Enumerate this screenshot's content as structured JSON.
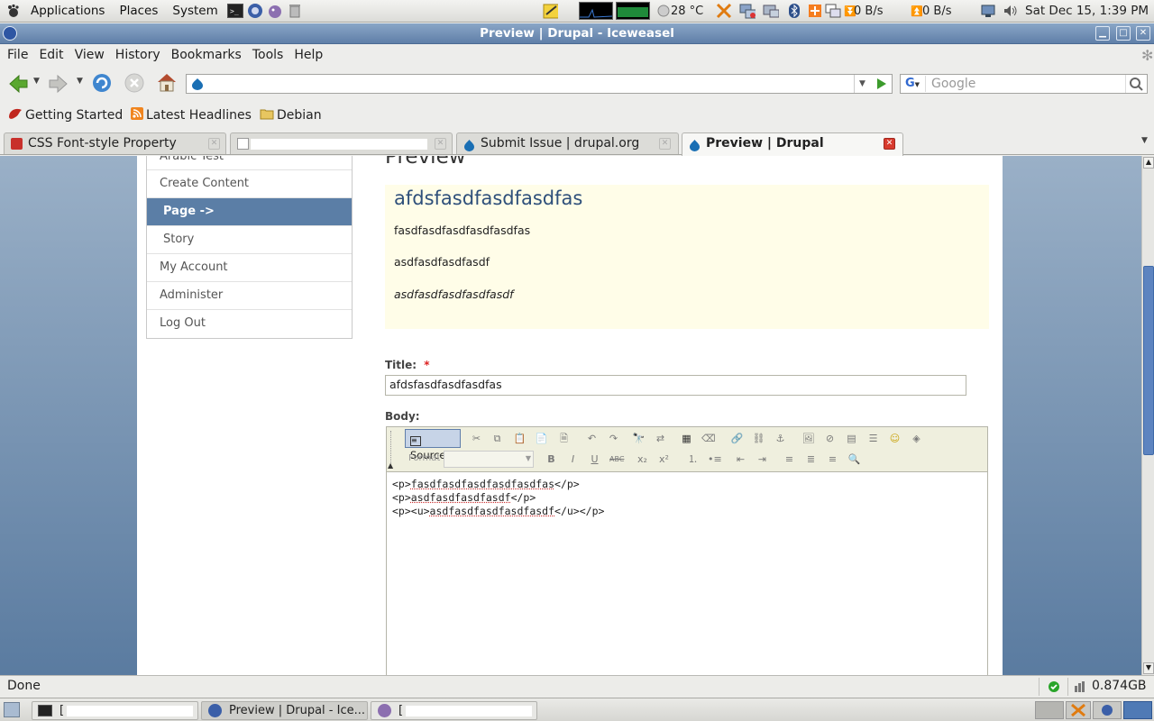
{
  "top_panel": {
    "menus": [
      "Applications",
      "Places",
      "System"
    ],
    "temperature": "28 °C",
    "net_down": "0 B/s",
    "net_up": "0 B/s",
    "clock": "Sat Dec 15,  1:39 PM"
  },
  "window": {
    "title": "Preview | Drupal - Iceweasel"
  },
  "menubar": [
    "File",
    "Edit",
    "View",
    "History",
    "Bookmarks",
    "Tools",
    "Help"
  ],
  "navbar": {
    "url": "",
    "search_placeholder": "Google"
  },
  "bookmarks": [
    "Getting Started",
    "Latest Headlines",
    "Debian"
  ],
  "tabs": [
    {
      "label": "CSS Font-style Property"
    },
    {
      "label": ""
    },
    {
      "label": "Submit Issue | drupal.org"
    },
    {
      "label": "Preview | Drupal"
    }
  ],
  "sidebar": {
    "items": [
      {
        "label": "Arabic Test"
      },
      {
        "label": "Create Content"
      },
      {
        "label": "Page ->"
      },
      {
        "label": "Story"
      },
      {
        "label": "My Account"
      },
      {
        "label": "Administer"
      },
      {
        "label": "Log Out"
      }
    ]
  },
  "main": {
    "heading": "Preview",
    "preview": {
      "title": "afdsfasdfasdfasdfas",
      "paragraphs": [
        "fasdfasdfasdfasdfasdfas",
        "asdfasdfasdfasdf",
        "asdfasdfasdfasdfasdf"
      ]
    },
    "title_label": "Title:",
    "required_mark": "*",
    "title_value": "afdsfasdfasdfasdfas",
    "body_label": "Body:",
    "editor": {
      "source_label": "Source",
      "format_label": "Format",
      "lines": [
        {
          "open": "<p>",
          "text": "fasdfasdfasdfasdfasdfas",
          "close": "</p>"
        },
        {
          "open": "<p>",
          "text": "asdfasdfasdfasdf",
          "close": "</p>"
        },
        {
          "open": "<p><u>",
          "text": "asdfasdfasdfasdfasdf",
          "close": "</u></p>"
        }
      ]
    }
  },
  "statusbar": {
    "status": "Done",
    "memory": "0.874GB"
  },
  "taskbar": [
    {
      "label": "["
    },
    {
      "label": "Preview | Drupal - Ice..."
    },
    {
      "label": "["
    }
  ],
  "colors": {
    "accent": "#5b7ea6",
    "preview_bg": "#fffde8",
    "desktop_top": "#9ab0c7",
    "desktop_bottom": "#5a7ba0"
  }
}
